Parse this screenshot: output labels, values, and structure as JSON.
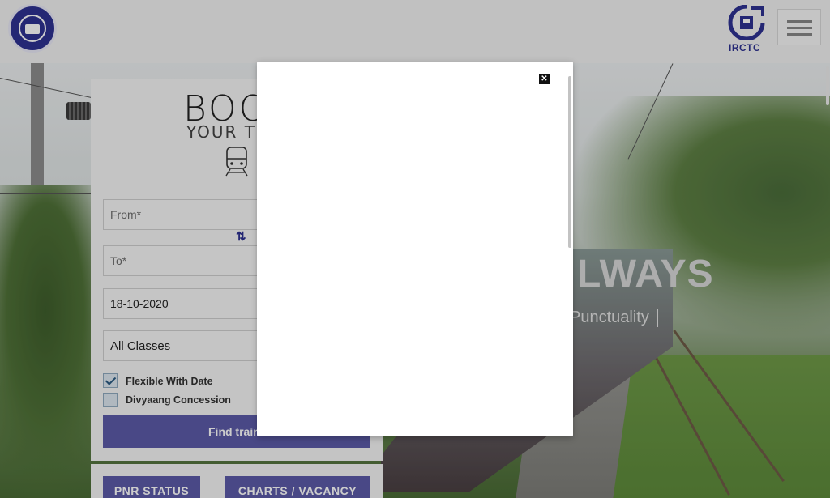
{
  "header": {
    "left_logo": "indian-railways-logo",
    "right_logo_text": "IRCTC",
    "menu_icon": "hamburger-icon"
  },
  "hero": {
    "title": "LWAYS",
    "subtitle": "Punctuality"
  },
  "booking": {
    "title": "BOO",
    "subtitle": "YOUR TIC",
    "from_placeholder": "From*",
    "to_placeholder": "To*",
    "date_value": "18-10-2020",
    "class_value": "All Classes",
    "flexible_label": "Flexible With Date",
    "flexible_checked": true,
    "divyaang_label": "Divyaang Concession",
    "divyaang_checked": false,
    "find_button": "Find train",
    "swap_icon": "swap-arrows-icon"
  },
  "quick_buttons": {
    "pnr": "PNR STATUS",
    "charts": "CHARTS / VACANCY"
  },
  "modal": {
    "close_icon": "close-icon"
  },
  "colors": {
    "brand": "#2e3192",
    "button": "#5c5aa8"
  }
}
